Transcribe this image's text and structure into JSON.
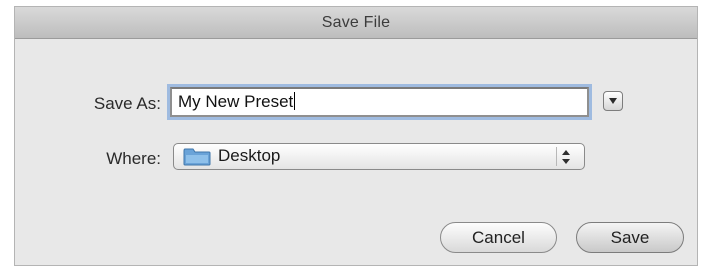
{
  "window": {
    "title": "Save File"
  },
  "form": {
    "save_as_label": "Save As:",
    "file_name_value": "My New Preset",
    "where_label": "Where:",
    "location_value": "Desktop"
  },
  "buttons": {
    "cancel_label": "Cancel",
    "save_label": "Save"
  },
  "icons": {
    "disclosure": "chevron-down-icon",
    "location": "folder-icon",
    "stepper": "up-down-arrows-icon"
  },
  "colors": {
    "focus_ring": "#9fbbe0",
    "folder": "#6aa3d8"
  }
}
